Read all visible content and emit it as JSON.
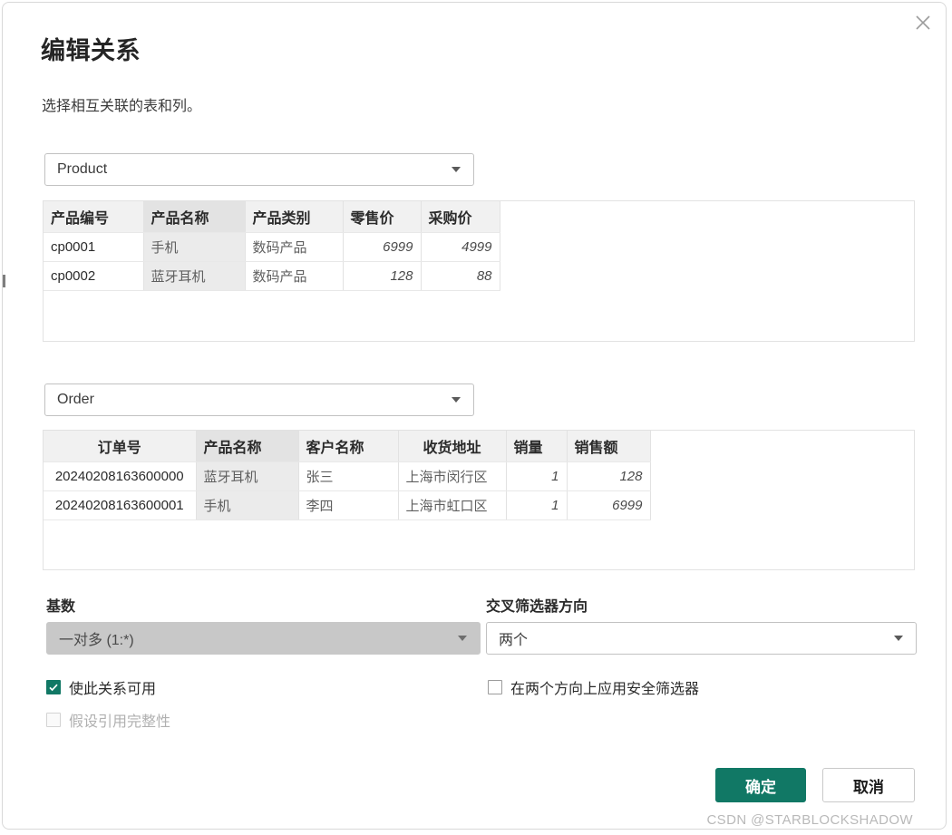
{
  "dialog": {
    "title": "编辑关系",
    "subtitle": "选择相互关联的表和列。",
    "close_icon": "close-icon",
    "accent_color": "#117865",
    "watermark": "CSDN @STARBLOCKSHADOW"
  },
  "tables": [
    {
      "selector_value": "Product",
      "selected_column": "产品名称",
      "columns": [
        "产品编号",
        "产品名称",
        "产品类别",
        "零售价",
        "采购价"
      ],
      "rows": [
        [
          "cp0001",
          "手机",
          "数码产品",
          "6999",
          "4999"
        ],
        [
          "cp0002",
          "蓝牙耳机",
          "数码产品",
          "128",
          "88"
        ]
      ]
    },
    {
      "selector_value": "Order",
      "selected_column": "产品名称",
      "columns": [
        "订单号",
        "产品名称",
        "客户名称",
        "收货地址",
        "销量",
        "销售额"
      ],
      "rows": [
        [
          "20240208163600000",
          "蓝牙耳机",
          "张三",
          "上海市闵行区",
          "1",
          "128"
        ],
        [
          "20240208163600001",
          "手机",
          "李四",
          "上海市虹口区",
          "1",
          "6999"
        ]
      ]
    }
  ],
  "options": {
    "cardinality_label": "基数",
    "cardinality_value": "一对多 (1:*)",
    "crossfilter_label": "交叉筛选器方向",
    "crossfilter_value": "两个",
    "check_active_label": "使此关系可用",
    "check_integrity_label": "假设引用完整性",
    "check_bidir_label": "在两个方向上应用安全筛选器"
  },
  "footer": {
    "ok_label": "确定",
    "cancel_label": "取消"
  }
}
